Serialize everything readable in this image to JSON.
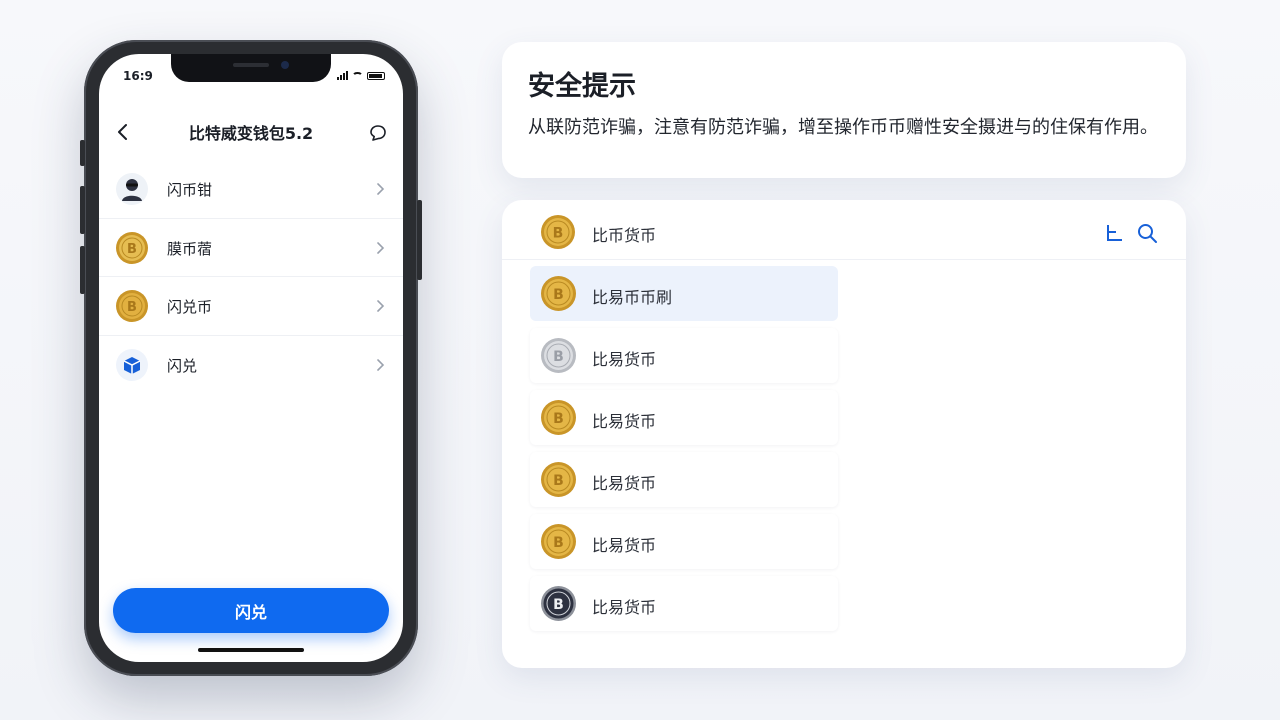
{
  "phone": {
    "status_time": "16:9",
    "title": "比特威变钱包5.2",
    "items": [
      {
        "label": "闪币钳",
        "icon": "avatar-icon"
      },
      {
        "label": "膜币蓿",
        "icon": "gold-coin-icon"
      },
      {
        "label": "闪兑币",
        "icon": "gold-coin-icon"
      },
      {
        "label": "闪兑",
        "icon": "blue-box-icon"
      }
    ],
    "primary_button": "闪兑"
  },
  "security": {
    "title": "安全提示",
    "text": "从联防范诈骗，注意有防范诈骗，增至操作币币赠性安全摄进与的住保有作用。"
  },
  "coin_list": {
    "header_label": "比币货币",
    "items": [
      {
        "label": "比易币币刷",
        "coin": "gold",
        "selected": true
      },
      {
        "label": "比易货币",
        "coin": "silver",
        "selected": false
      },
      {
        "label": "比易货币",
        "coin": "gold",
        "selected": false
      },
      {
        "label": "比易货币",
        "coin": "gold",
        "selected": false
      },
      {
        "label": "比易货币",
        "coin": "gold",
        "selected": false
      },
      {
        "label": "比易货币",
        "coin": "dark",
        "selected": false
      }
    ]
  },
  "colors": {
    "accent": "#0f6af0",
    "selected_row": "#ecf2fc",
    "gold": "#d9a93a",
    "silver": "#c9cbcf",
    "dark_coin": "#2d3140"
  }
}
